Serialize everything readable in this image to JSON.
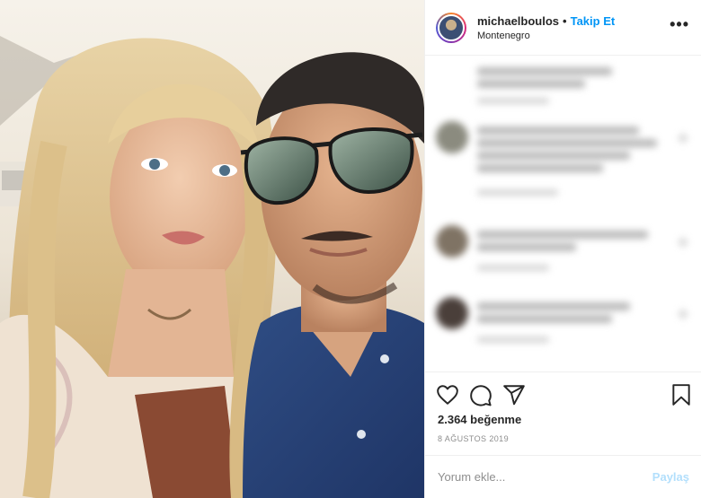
{
  "post": {
    "username": "michaelboulos",
    "separator": "•",
    "follow_label": "Takip Et",
    "location": "Montenegro",
    "more_glyph": "•••",
    "likes_text": "2.364 beğenme",
    "date": "8 AĞUSTOS 2019"
  },
  "comment_box": {
    "placeholder": "Yorum ekle...",
    "post_label": "Paylaş"
  },
  "icons": {
    "like": "heart-icon",
    "comment": "comment-icon",
    "share": "paper-plane-icon",
    "save": "bookmark-icon",
    "more": "more-options-icon"
  },
  "colors": {
    "link_blue": "#0095f6",
    "disabled_blue": "#b2dffc",
    "text": "#262626",
    "muted": "#8e8e8e",
    "divider": "#efefef"
  }
}
